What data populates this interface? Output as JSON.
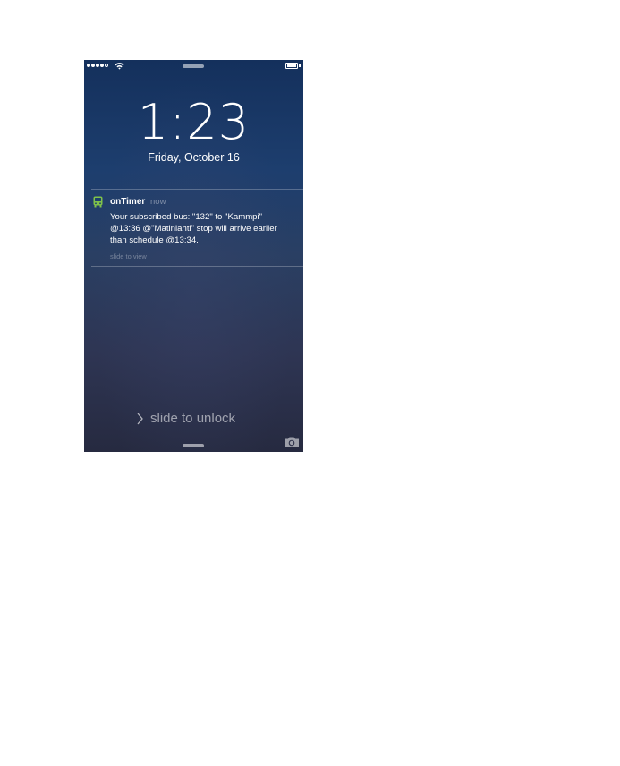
{
  "lockscreen": {
    "time_hour": "1",
    "time_minutes": "23",
    "date": "Friday, October 16"
  },
  "notification": {
    "app_name": "onTimer",
    "time_ago": "now",
    "message_lines": [
      "Your subscribed bus: \"132\" to \"Kammpi\"",
      "@13:36 @\"Matinlahti\" stop will arrive earlier",
      "than schedule @13:34."
    ],
    "action_hint": "slide to view",
    "icon": "bus-icon",
    "icon_color": "#7fc24a"
  },
  "unlock": {
    "label": "slide to unlock"
  },
  "status_bar": {
    "signal_bars_filled": 4,
    "signal_bars_total": 5,
    "icons": [
      "signal-icon",
      "wifi-icon",
      "battery-icon"
    ]
  },
  "camera": {
    "icon": "camera-icon"
  }
}
